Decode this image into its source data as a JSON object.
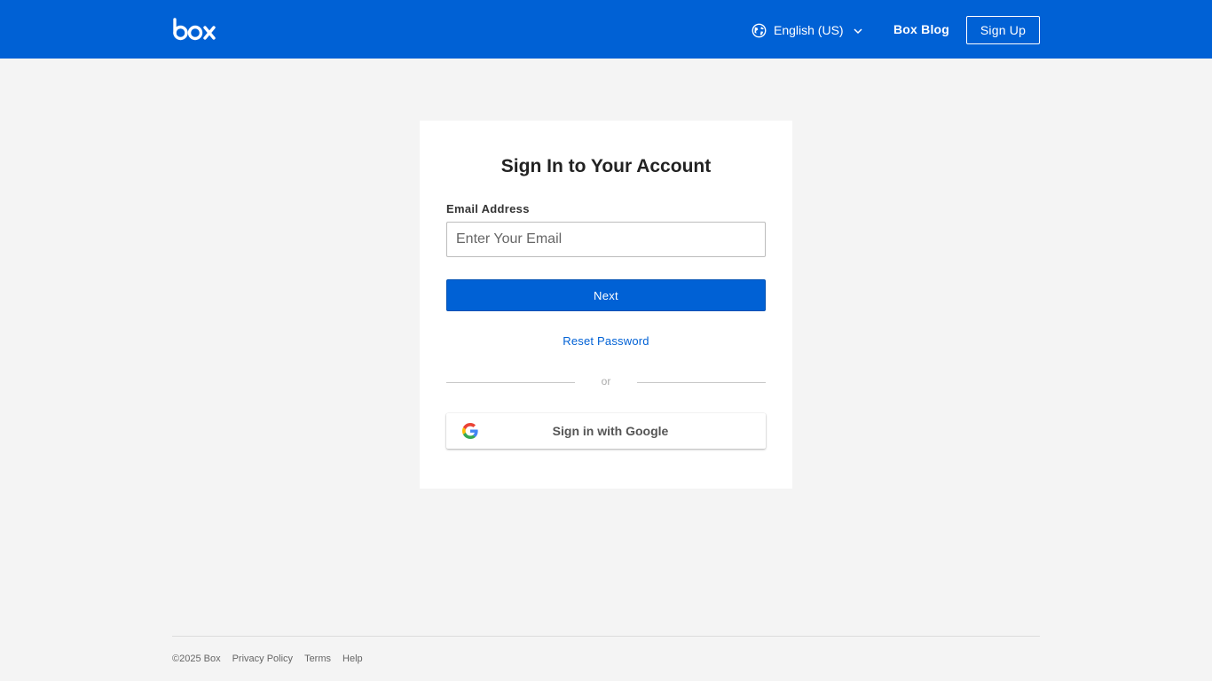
{
  "header": {
    "logo_text": "box",
    "language_label": "English (US)",
    "blog_label": "Box Blog",
    "signup_label": "Sign Up"
  },
  "login_card": {
    "title": "Sign In to Your Account",
    "email_label": "Email Address",
    "email_placeholder": "Enter Your Email",
    "email_value": "",
    "next_label": "Next",
    "reset_label": "Reset Password",
    "divider_text": "or",
    "google_label": "Sign in with Google"
  },
  "footer": {
    "copyright": "©2025 Box",
    "links": [
      "Privacy Policy",
      "Terms",
      "Help"
    ]
  },
  "colors": {
    "brand_blue": "#0061d5",
    "page_background": "#f4f4f4",
    "card_background": "#ffffff"
  },
  "icons": {
    "language": "globe-icon",
    "language_dropdown": "chevron-down-icon",
    "google": "google-g-icon"
  }
}
